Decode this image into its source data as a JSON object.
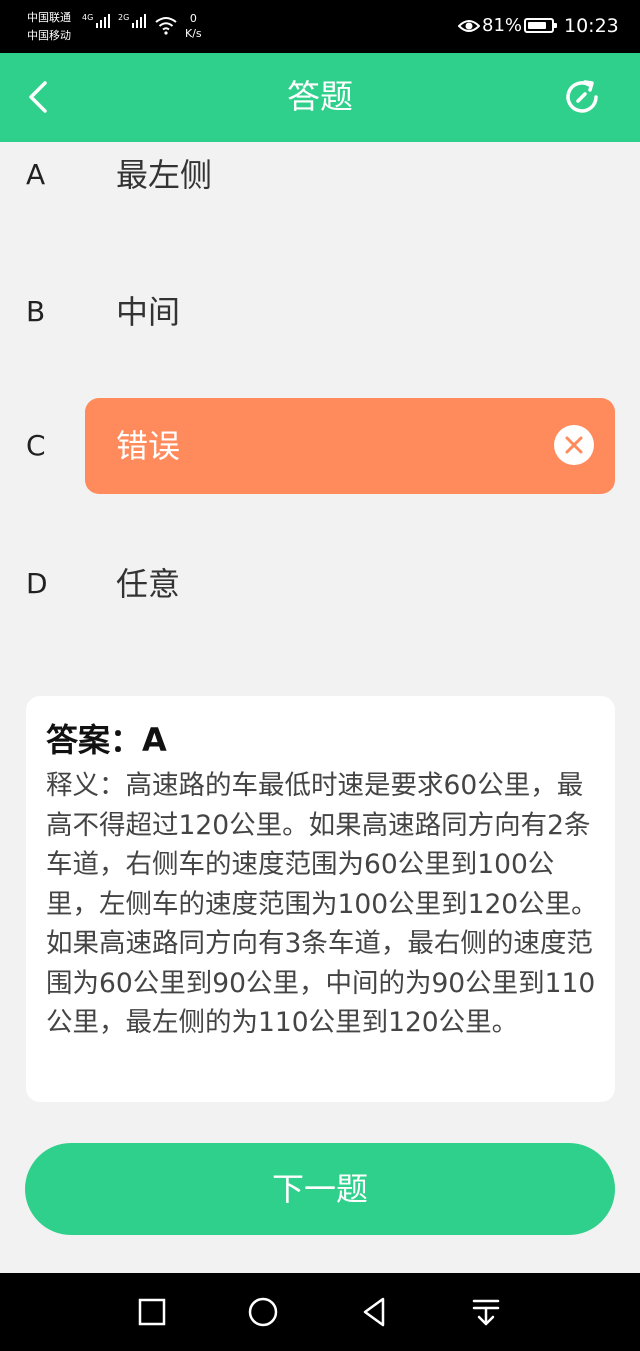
{
  "status_bar": {
    "carrier1": "中国联通",
    "carrier2": "中国移动",
    "network1": "4G",
    "network2": "2G",
    "speed_value": "0",
    "speed_unit": "K/s",
    "battery_percent": "81%",
    "battery_level": 0.81,
    "time": "10:23"
  },
  "header": {
    "title": "答题",
    "back_icon": "chevron-left-icon",
    "refresh_icon": "refresh-icon"
  },
  "options": [
    {
      "letter": "A",
      "text": "最左侧",
      "state": "normal"
    },
    {
      "letter": "B",
      "text": "中间",
      "state": "normal"
    },
    {
      "letter": "C",
      "text": "错误",
      "state": "wrong"
    },
    {
      "letter": "D",
      "text": "任意",
      "state": "normal"
    }
  ],
  "explanation": {
    "answer": "答案：A",
    "text": "释义：高速路的车最低时速是要求60公里，最高不得超过120公里。如果高速路同方向有2条车道，右侧车的速度范围为60公里到100公里，左侧车的速度范围为100公里到120公里。如果高速路同方向有3条车道，最右侧的速度范围为60公里到90公里，中间的为90公里到110公里，最左侧的为110公里到120公里。"
  },
  "next_button": {
    "label": "下一题"
  },
  "nav_bar": {
    "icons": [
      "square-icon",
      "circle-icon",
      "triangle-back-icon",
      "notification-pull-icon"
    ]
  },
  "colors": {
    "accent": "#2fd08b",
    "wrong": "#ff8a5b",
    "background": "#f2f2f2"
  }
}
